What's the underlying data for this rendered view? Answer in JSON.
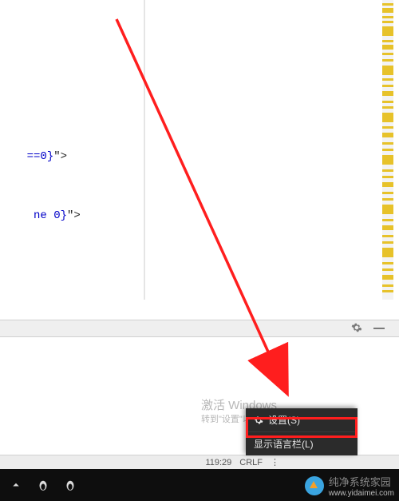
{
  "editor": {
    "code_lines": {
      "line1_attr": "==0}",
      "line1_tail": "\">",
      "line2_attr": " ne 0}",
      "line2_tail": "\">"
    }
  },
  "panel": {
    "gear_name": "gear-icon",
    "dash_name": "minimize"
  },
  "activation": {
    "title": "激活 Windows",
    "subtitle": "转到\"设置\"以激活 Windows。"
  },
  "ime_popup": {
    "settings_label": "设置(S)",
    "lang_bar_label": "显示语言栏(L)"
  },
  "status": {
    "pos": "119:29",
    "eol": "CRLF"
  },
  "promo": {
    "title": "纯净系统家园",
    "url": "www.yidaimei.com"
  },
  "taskbar": {
    "icons": [
      "chevron-up-icon",
      "penguin-icon",
      "penguin-icon"
    ]
  }
}
